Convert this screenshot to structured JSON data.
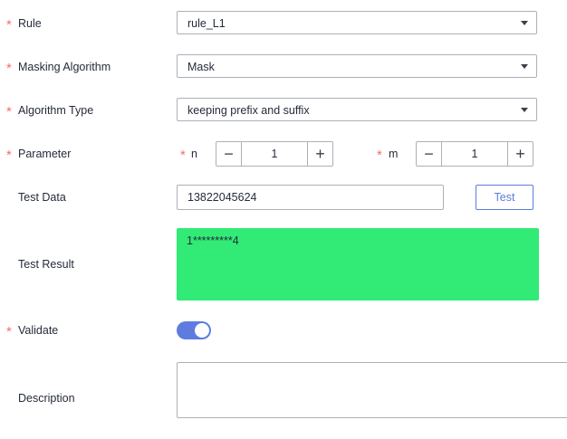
{
  "form": {
    "rule": {
      "label": "Rule",
      "required_mark": "*",
      "value": "rule_L1"
    },
    "masking_algorithm": {
      "label": "Masking Algorithm",
      "required_mark": "*",
      "value": "Mask"
    },
    "algorithm_type": {
      "label": "Algorithm Type",
      "required_mark": "*",
      "value": "keeping prefix and suffix"
    },
    "parameter": {
      "label": "Parameter",
      "required_mark": "*",
      "n": {
        "label": "n",
        "required_mark": "*",
        "value": "1",
        "minus": "−",
        "plus": "+"
      },
      "m": {
        "label": "m",
        "required_mark": "*",
        "value": "1",
        "minus": "−",
        "plus": "+"
      }
    },
    "test_data": {
      "label": "Test Data",
      "value": "13822045624",
      "button_label": "Test"
    },
    "test_result": {
      "label": "Test Result",
      "value": "1*********4",
      "background": "#31eb76"
    },
    "validate": {
      "label": "Validate",
      "required_mark": "*",
      "enabled": true,
      "color": "#5e7ce0"
    },
    "description": {
      "label": "Description",
      "value": ""
    }
  }
}
